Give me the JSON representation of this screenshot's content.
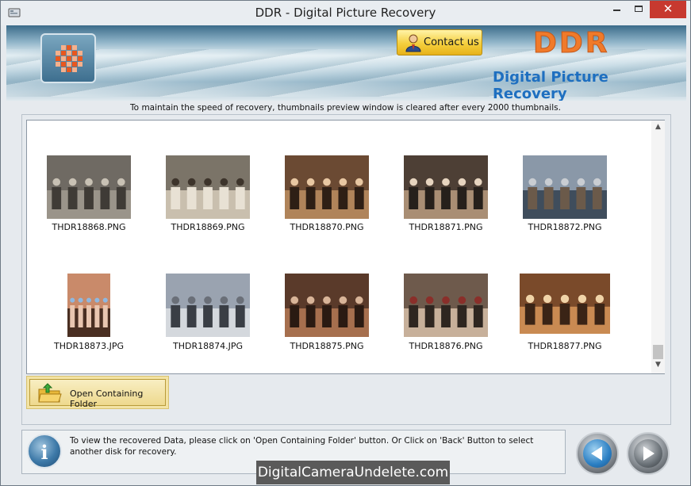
{
  "window": {
    "title": "DDR - Digital Picture Recovery",
    "close_glyph": "✕"
  },
  "header": {
    "contact_label": "Contact us",
    "brand": "DDR",
    "brand_subtitle": "Digital Picture Recovery"
  },
  "notice": "To maintain the speed of recovery, thumbnails preview window is cleared after every 2000 thumbnails.",
  "thumbnails": [
    {
      "name": "THDR18868.PNG"
    },
    {
      "name": "THDR18869.PNG"
    },
    {
      "name": "THDR18870.PNG"
    },
    {
      "name": "THDR18871.PNG"
    },
    {
      "name": "THDR18872.PNG"
    },
    {
      "name": "THDR18873.JPG"
    },
    {
      "name": "THDR18874.JPG"
    },
    {
      "name": "THDR18875.PNG"
    },
    {
      "name": "THDR18876.PNG"
    },
    {
      "name": "THDR18877.PNG"
    }
  ],
  "actions": {
    "open_folder_label": "Open Containing Folder"
  },
  "footer": {
    "info_glyph": "i",
    "instructions": "To view the recovered Data, please click on 'Open Containing Folder' button. Or Click on 'Back' Button to select another disk for recovery."
  },
  "watermark": "DigitalCameraUndelete.com",
  "icons": {
    "app": "app-icon",
    "logo": "ddr-logo-icon",
    "contact": "person-icon",
    "folder": "open-folder-icon",
    "info": "info-icon",
    "back": "back-arrow-icon",
    "next": "next-arrow-icon"
  },
  "colors": {
    "brand_orange": "#f07a2a",
    "brand_blue": "#1e6fc0",
    "contact_gold": "#f5cf3d",
    "close_red": "#c7392f"
  }
}
